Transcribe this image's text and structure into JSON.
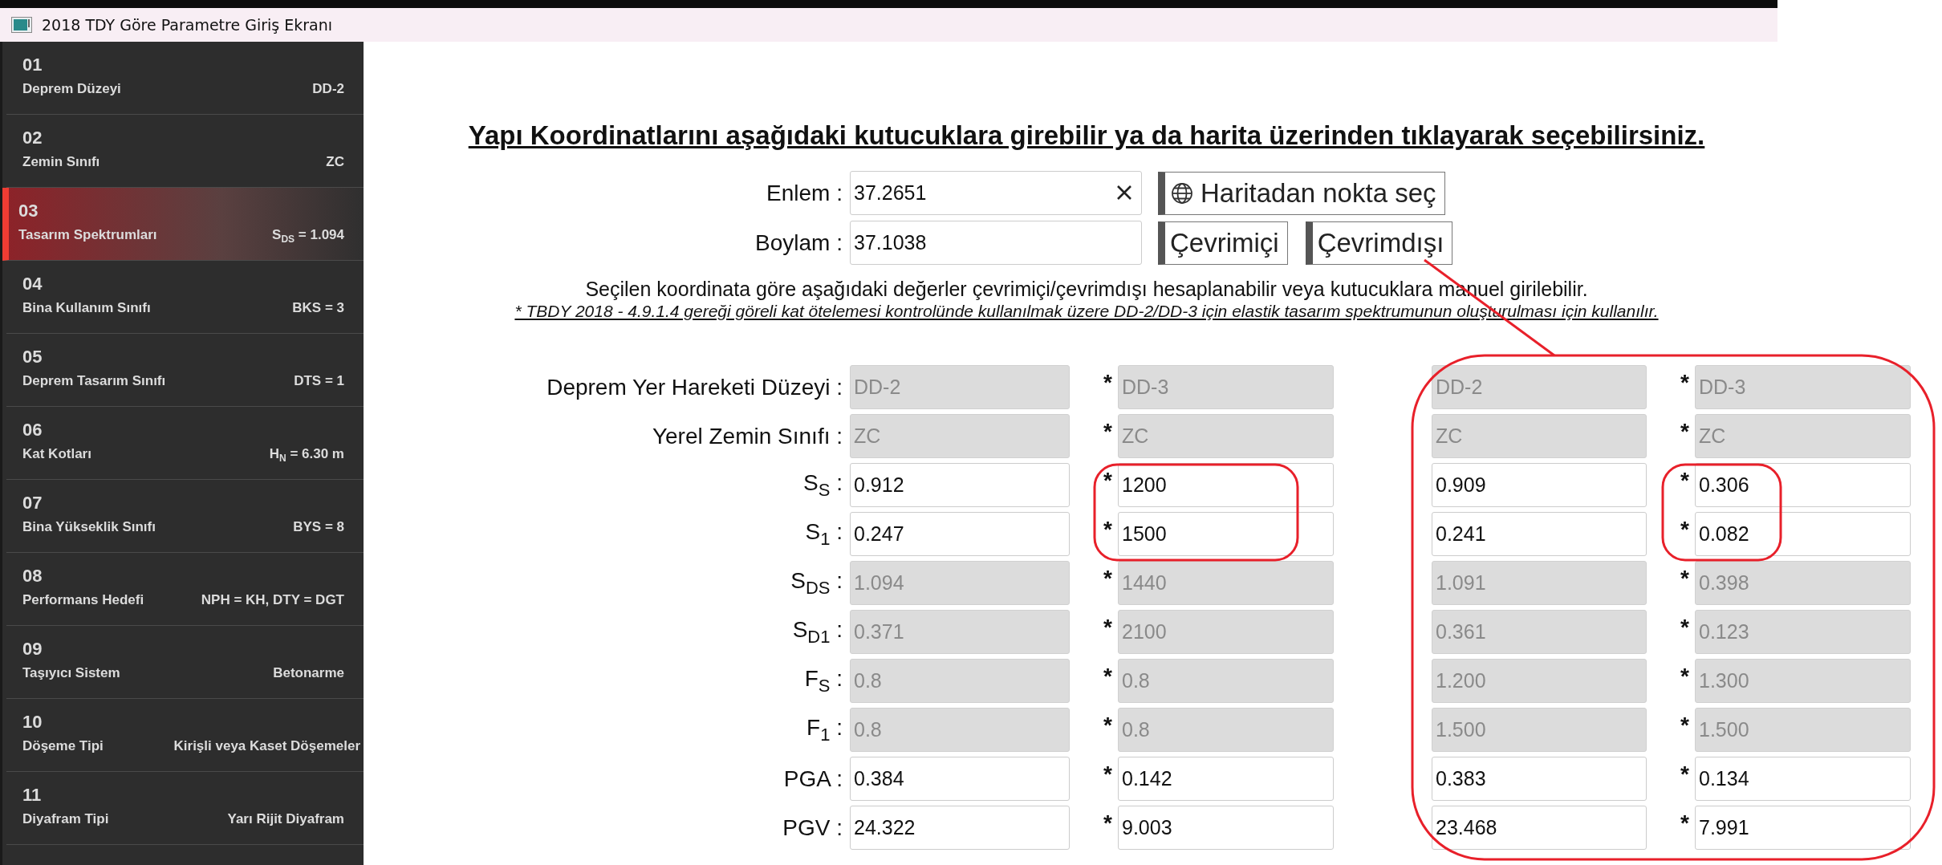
{
  "window": {
    "title": "2018 TDY Göre Parametre Giriş Ekranı"
  },
  "sidebar": {
    "items": [
      {
        "number": "01",
        "title": "Deprem Düzeyi",
        "value": "DD-2",
        "selected": false
      },
      {
        "number": "02",
        "title": "Zemin Sınıfı",
        "value": "ZC",
        "selected": false
      },
      {
        "number": "03",
        "title": "Tasarım Spektrumları",
        "value": "S$_{DS}$ = 1.094",
        "selected": true
      },
      {
        "number": "04",
        "title": "Bina Kullanım Sınıfı",
        "value": "BKS = 3",
        "selected": false
      },
      {
        "number": "05",
        "title": "Deprem Tasarım Sınıfı",
        "value": "DTS = 1",
        "selected": false
      },
      {
        "number": "06",
        "title": "Kat Kotları",
        "value": "H$_{N}$ = 6.30 m",
        "selected": false
      },
      {
        "number": "07",
        "title": "Bina Yükseklik Sınıfı",
        "value": "BYS = 8",
        "selected": false
      },
      {
        "number": "08",
        "title": "Performans Hedefi",
        "value": "NPH = KH, DTY = DGT",
        "selected": false
      },
      {
        "number": "09",
        "title": "Taşıyıcı Sistem",
        "value": "Betonarme",
        "selected": false
      },
      {
        "number": "10",
        "title": "Döşeme Tipi",
        "value": "Kirişli veya Kaset Döşemeler",
        "selected": false
      },
      {
        "number": "11",
        "title": "Diyafram Tipi",
        "value": "Yarı Rijit Diyafram",
        "selected": false
      }
    ]
  },
  "heading": "Yapı Koordinatlarını aşağıdaki kutucuklara girebilir ya da harita üzerinden tıklayarak seçebilirsiniz.",
  "coordinates": [
    {
      "label": "Enlem :",
      "value": "37.2651",
      "clearable": true,
      "buttons": [
        {
          "label": "Haritadan nokta seç",
          "kind": "map"
        }
      ]
    },
    {
      "label": "Boylam :",
      "value": "37.1038",
      "clearable": false,
      "buttons": [
        {
          "label": "Çevrimiçi",
          "kind": "text"
        },
        {
          "label": "Çevrimdışı",
          "kind": "text"
        }
      ]
    }
  ],
  "info_text": "Seçilen koordinata göre aşağıdaki değerler çevrimiçi/çevrimdışı hesaplanabilir veya kutucuklara manuel girilebilir.",
  "note_text": "* TBDY 2018 - 4.9.1.4 gereği göreli kat ötelemesi kontrolünde kullanılmak üzere DD-2/DD-3 için elastik tasarım spektrumunun oluşturulması için kullanılır.",
  "parameters": [
    {
      "label": "Deprem Yer Hareketi Düzeyi :",
      "disabled": true,
      "cells": [
        {
          "value": "DD-2"
        },
        {
          "mark": "*",
          "value": "DD-3"
        },
        {
          "value": "DD-2"
        },
        {
          "mark": "*",
          "value": "DD-3"
        }
      ]
    },
    {
      "label": "Yerel Zemin Sınıfı :",
      "disabled": true,
      "cells": [
        {
          "value": "ZC"
        },
        {
          "mark": "*",
          "value": "ZC"
        },
        {
          "value": "ZC"
        },
        {
          "mark": "*",
          "value": "ZC"
        }
      ]
    },
    {
      "label": "S$_{S}$ :",
      "disabled": false,
      "cells": [
        {
          "value": "0.912"
        },
        {
          "mark": "*",
          "value": "1200"
        },
        {
          "value": "0.909"
        },
        {
          "mark": "*",
          "value": "0.306"
        }
      ]
    },
    {
      "label": "S$_{1}$ :",
      "disabled": false,
      "cells": [
        {
          "value": "0.247"
        },
        {
          "mark": "*",
          "value": "1500"
        },
        {
          "value": "0.241"
        },
        {
          "mark": "*",
          "value": "0.082"
        }
      ]
    },
    {
      "label": "S$_{DS}$ :",
      "disabled": true,
      "cells": [
        {
          "value": "1.094"
        },
        {
          "mark": "*",
          "value": "1440"
        },
        {
          "value": "1.091"
        },
        {
          "mark": "*",
          "value": "0.398"
        }
      ]
    },
    {
      "label": "S$_{D1}$ :",
      "disabled": true,
      "cells": [
        {
          "value": "0.371"
        },
        {
          "mark": "*",
          "value": "2100"
        },
        {
          "value": "0.361"
        },
        {
          "mark": "*",
          "value": "0.123"
        }
      ]
    },
    {
      "label": "F$_{S}$ :",
      "disabled": true,
      "cells": [
        {
          "value": "0.8"
        },
        {
          "mark": "*",
          "value": "0.8"
        },
        {
          "value": "1.200"
        },
        {
          "mark": "*",
          "value": "1.300"
        }
      ]
    },
    {
      "label": "F$_{1}$ :",
      "disabled": true,
      "cells": [
        {
          "value": "0.8"
        },
        {
          "mark": "*",
          "value": "0.8"
        },
        {
          "value": "1.500"
        },
        {
          "mark": "*",
          "value": "1.500"
        }
      ]
    },
    {
      "label": "PGA :",
      "disabled": false,
      "cells": [
        {
          "value": "0.384"
        },
        {
          "mark": "*",
          "value": "0.142"
        },
        {
          "value": "0.383"
        },
        {
          "mark": "*",
          "value": "0.134"
        }
      ]
    },
    {
      "label": "PGV :",
      "disabled": false,
      "cells": [
        {
          "value": "24.322"
        },
        {
          "mark": "*",
          "value": "9.003"
        },
        {
          "value": "23.468"
        },
        {
          "mark": "*",
          "value": "7.991"
        }
      ]
    }
  ]
}
